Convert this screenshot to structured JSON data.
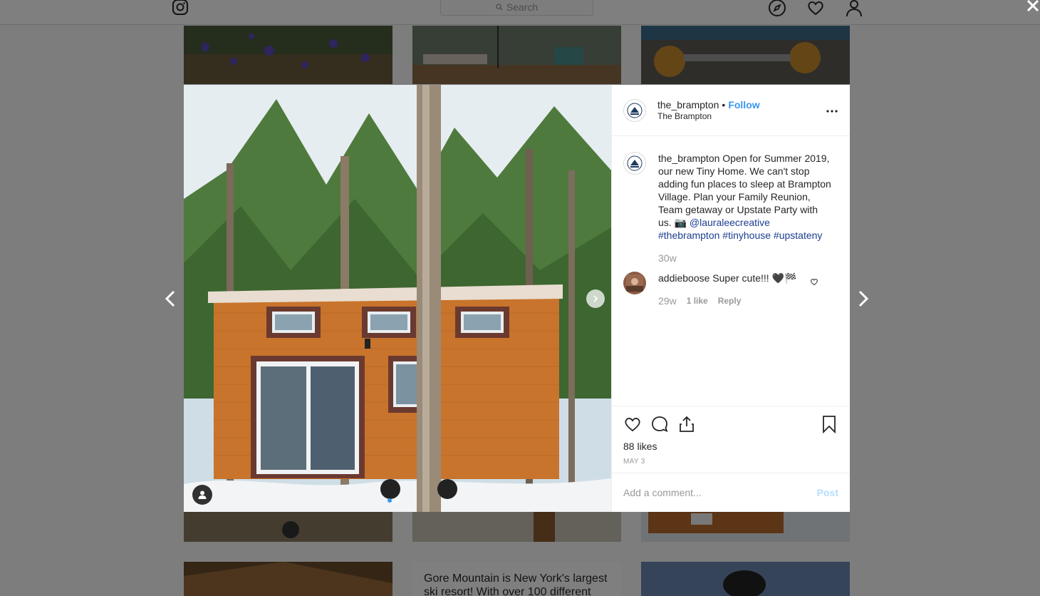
{
  "topbar": {
    "logo_icon": "instagram-icon",
    "search_placeholder": "Search",
    "icons": [
      "explore-icon",
      "heart-icon",
      "profile-icon"
    ]
  },
  "background": {
    "promo_text": "Gore Mountain is New York's largest ski resort! With over 100 different"
  },
  "post": {
    "username": "the_brampton",
    "separator": "•",
    "follow_label": "Follow",
    "location": "The Brampton",
    "caption_user": "the_brampton",
    "caption_text": " Open for Summer 2019, our new Tiny Home. We can't stop adding fun places to sleep at Brampton Village. Plan your Family Reunion, Team getaway or Upstate Party with us. 📷 ",
    "caption_mention": "@lauraleecreative",
    "caption_tags": [
      "#thebrampton",
      "#tinyhouse",
      "#upstateny"
    ],
    "caption_age": "30w",
    "comments": [
      {
        "user": "addieboose",
        "text": " Super cute!!! 🖤🏁",
        "age": "29w",
        "likes": "1 like",
        "reply": "Reply"
      }
    ],
    "likes": "88 likes",
    "date": "MAY 3",
    "add_comment_placeholder": "Add a comment...",
    "post_label": "Post",
    "carousel_count": 2,
    "carousel_active": 1
  },
  "colors": {
    "accent": "#3897f0",
    "hashtag": "#1b3f8f",
    "muted": "#999999",
    "post_disabled": "#b2dffc"
  }
}
